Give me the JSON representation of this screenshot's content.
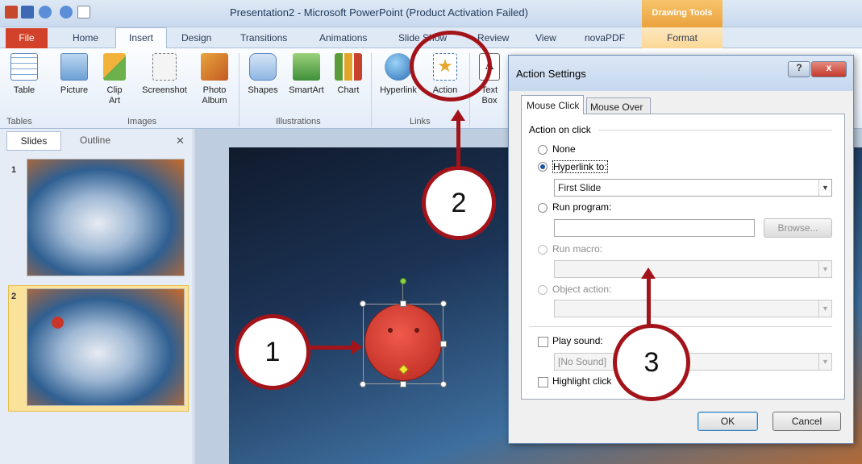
{
  "window": {
    "title": "Presentation2 - Microsoft PowerPoint (Product Activation Failed)",
    "context_tab": "Drawing Tools"
  },
  "tabs": {
    "file": "File",
    "home": "Home",
    "insert": "Insert",
    "design": "Design",
    "transitions": "Transitions",
    "animations": "Animations",
    "slideshow": "Slide Show",
    "review": "Review",
    "view": "View",
    "novapdf": "novaPDF",
    "format": "Format"
  },
  "ribbon": {
    "table": "Table",
    "picture": "Picture",
    "clipart": "Clip Art",
    "screenshot": "Screenshot",
    "photo_album": "Photo Album",
    "shapes": "Shapes",
    "smartart": "SmartArt",
    "chart": "Chart",
    "hyperlink": "Hyperlink",
    "action": "Action",
    "textbox": "Text Box",
    "groups": {
      "tables": "Tables",
      "images": "Images",
      "illustrations": "Illustrations",
      "links": "Links"
    }
  },
  "left_pane": {
    "tab_slides": "Slides",
    "tab_outline": "Outline",
    "slide1_num": "1",
    "slide2_num": "2"
  },
  "dialog": {
    "title": "Action Settings",
    "tab_mouse_click": "Mouse Click",
    "tab_mouse_over": "Mouse Over",
    "group_label": "Action on click",
    "opt_none": "None",
    "opt_hyperlink": "Hyperlink to:",
    "hyperlink_value": "First Slide",
    "opt_run_program": "Run program:",
    "browse": "Browse...",
    "opt_run_macro": "Run macro:",
    "opt_object_action": "Object action:",
    "play_sound": "Play sound:",
    "sound_value": "[No Sound]",
    "highlight_click": "Highlight click",
    "ok": "OK",
    "cancel": "Cancel",
    "help_glyph": "?",
    "close_glyph": "x"
  },
  "annotations": {
    "n1": "1",
    "n2": "2",
    "n3": "3"
  },
  "colors": {
    "annotation": "#a3131a",
    "file_tab": "#d2422a",
    "context_tab": "#eaa23c"
  }
}
